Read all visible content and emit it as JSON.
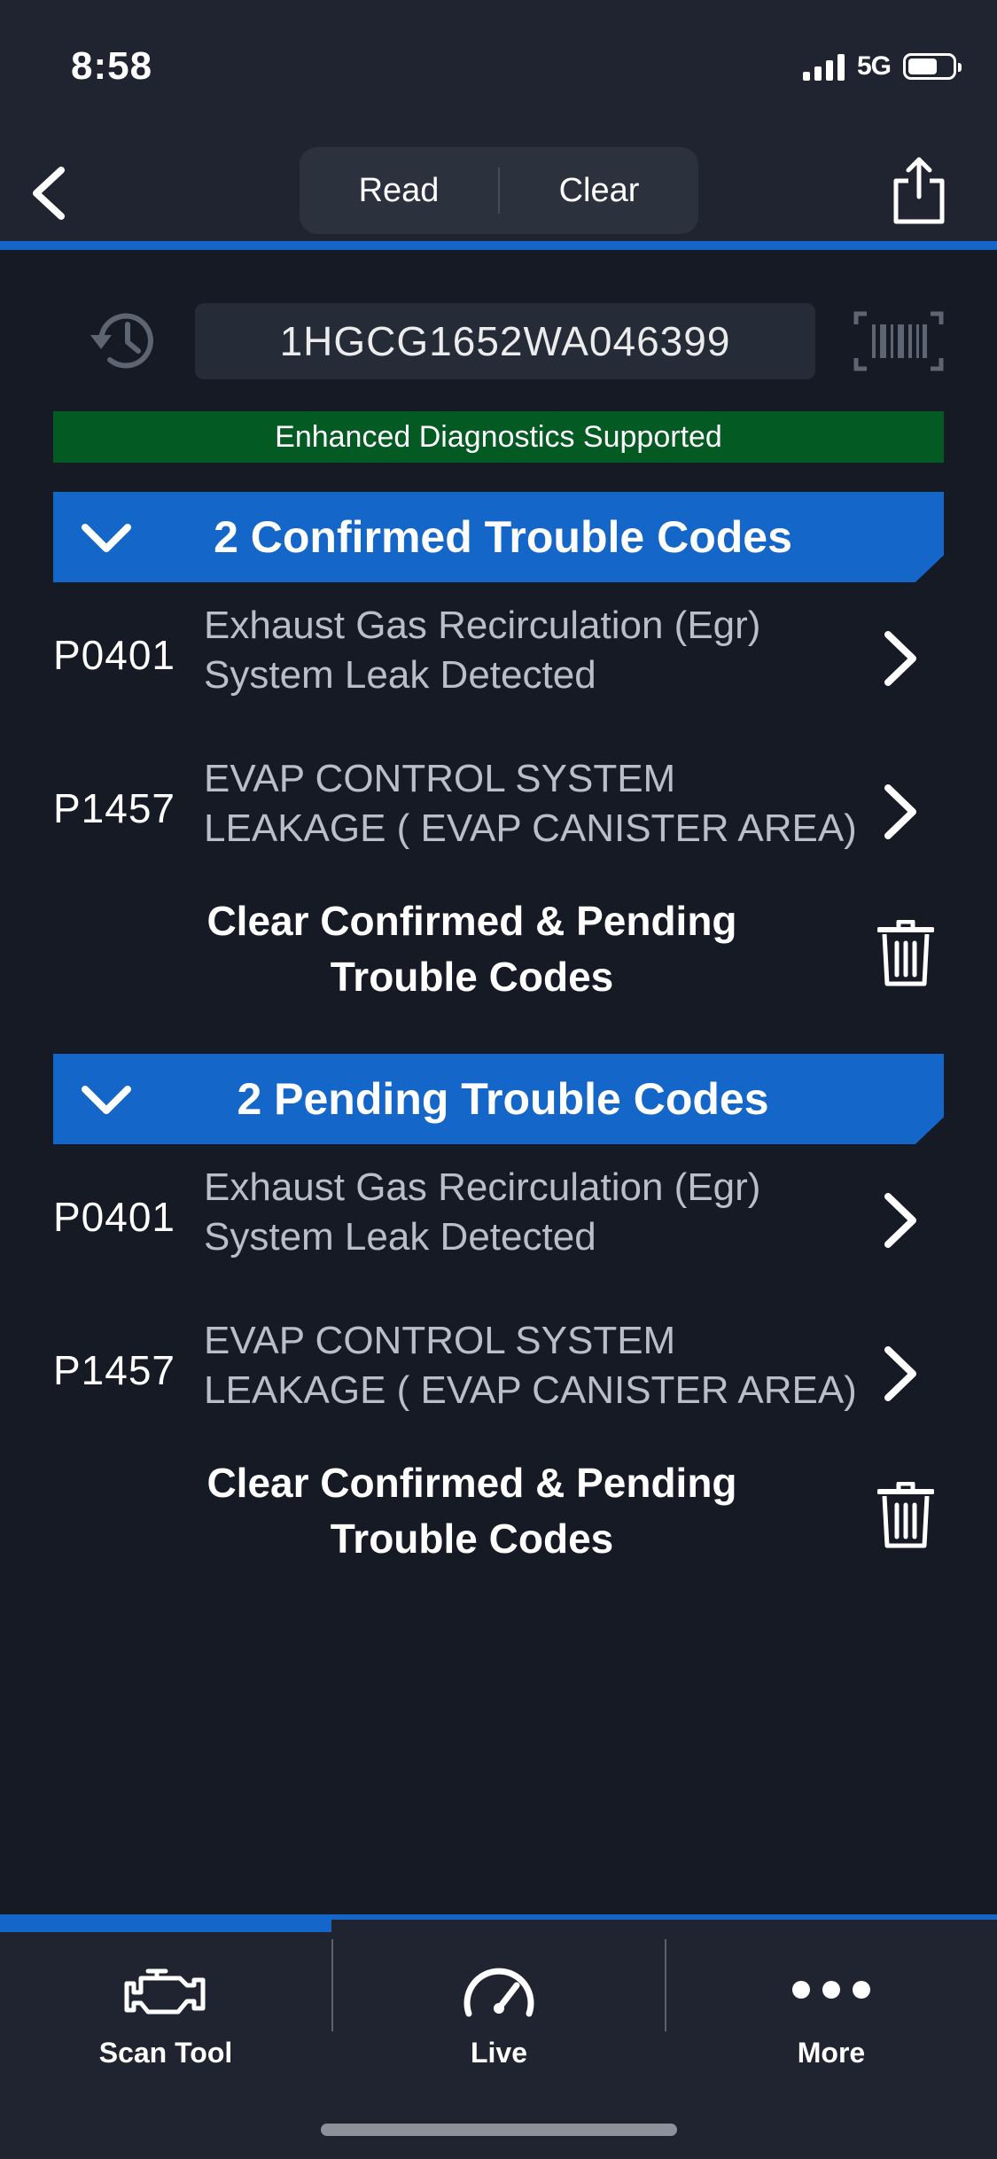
{
  "status": {
    "time": "8:58",
    "network": "5G"
  },
  "nav": {
    "read_label": "Read",
    "clear_label": "Clear"
  },
  "vin": {
    "value": "1HGCG1652WA046399"
  },
  "banner": {
    "text": "Enhanced Diagnostics Supported",
    "color": "#045a23"
  },
  "accent_color": "#1466c8",
  "confirmed": {
    "title": "2 Confirmed Trouble Codes",
    "codes": [
      {
        "code": "P0401",
        "line1": "Exhaust Gas Recirculation (Egr)",
        "line2": "System Leak Detected"
      },
      {
        "code": "P1457",
        "line1": "EVAP CONTROL SYSTEM",
        "line2": "LEAKAGE ( EVAP CANISTER AREA)"
      }
    ],
    "clear_line1": "Clear Confirmed & Pending",
    "clear_line2": "Trouble Codes"
  },
  "pending": {
    "title": "2 Pending Trouble Codes",
    "codes": [
      {
        "code": "P0401",
        "line1": "Exhaust Gas Recirculation (Egr)",
        "line2": "System Leak Detected"
      },
      {
        "code": "P1457",
        "line1": "EVAP CONTROL SYSTEM",
        "line2": "LEAKAGE ( EVAP CANISTER AREA)"
      }
    ],
    "clear_line1": "Clear Confirmed & Pending",
    "clear_line2": "Trouble Codes"
  },
  "tabs": [
    {
      "label": "Scan Tool",
      "icon": "engine-icon",
      "active": true
    },
    {
      "label": "Live",
      "icon": "speedometer-icon",
      "active": false
    },
    {
      "label": "More",
      "icon": "more-dots-icon",
      "active": false
    }
  ]
}
